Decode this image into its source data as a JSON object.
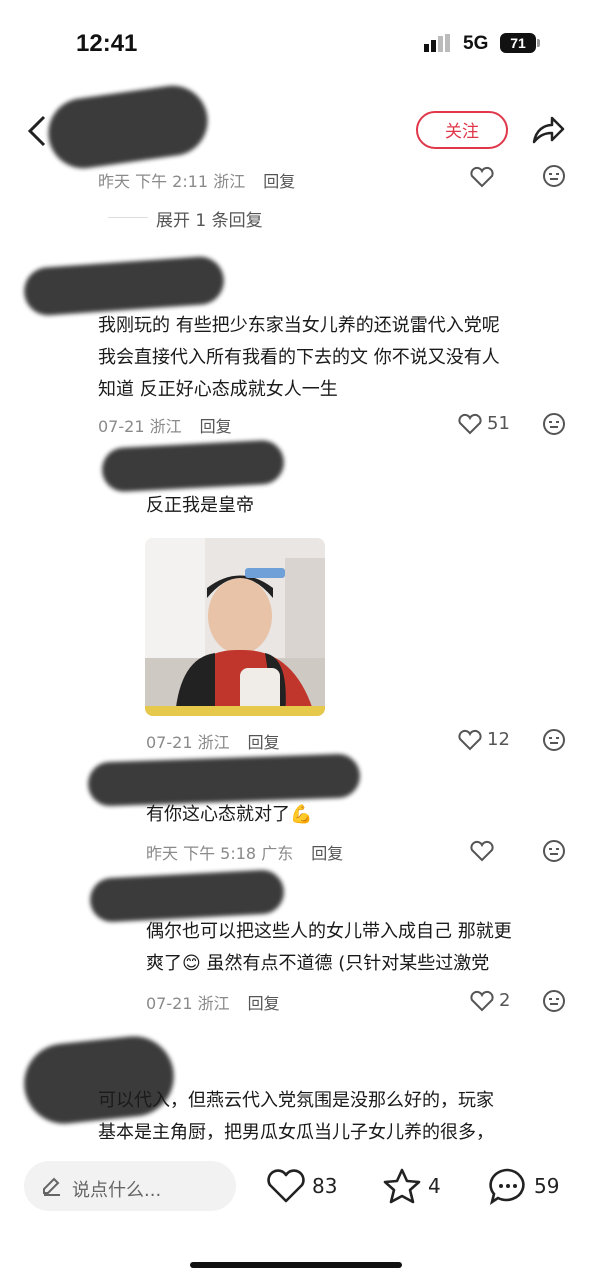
{
  "status_bar": {
    "time": "12:41",
    "network": "5G",
    "battery": "71"
  },
  "header": {
    "follow_label": "关注"
  },
  "top_partial": {
    "meta": "昨天 下午 2:11 浙江",
    "reply": "回复",
    "expand_label": "展开 1 条回复"
  },
  "comments": [
    {
      "text_lines": [
        "我刚玩的 有些把少东家当女儿养的还说雷代入党呢",
        "我会直接代入所有我看的下去的文 你不说又没有人",
        "知道 反正好心态成就女人一生"
      ],
      "meta": "07-21 浙江",
      "reply": "回复",
      "likes": "51"
    },
    {
      "text": "反正我是皇帝",
      "meta": "07-21 浙江",
      "reply": "回复",
      "likes": "12"
    },
    {
      "text": "有你这心态就对了",
      "emoji": "💪",
      "meta": "昨天 下午 5:18 广东",
      "reply": "回复"
    },
    {
      "text_lines": [
        "偶尔也可以把这些人的女儿带入成自己 那就更",
        "爽了",
        " 虽然有点不道德 (只针对某些过激党"
      ],
      "emoji": "😊",
      "meta": "07-21 浙江",
      "reply": "回复",
      "likes": "2"
    },
    {
      "text_lines": [
        "可以代入，但燕云代入党氛围是没那么好的，玩家",
        "基本是主角厨，把男瓜女瓜当儿子女儿养的很多，"
      ]
    }
  ],
  "bottom_bar": {
    "placeholder": "说点什么...",
    "likes": "83",
    "favorites": "4",
    "comments": "59"
  }
}
